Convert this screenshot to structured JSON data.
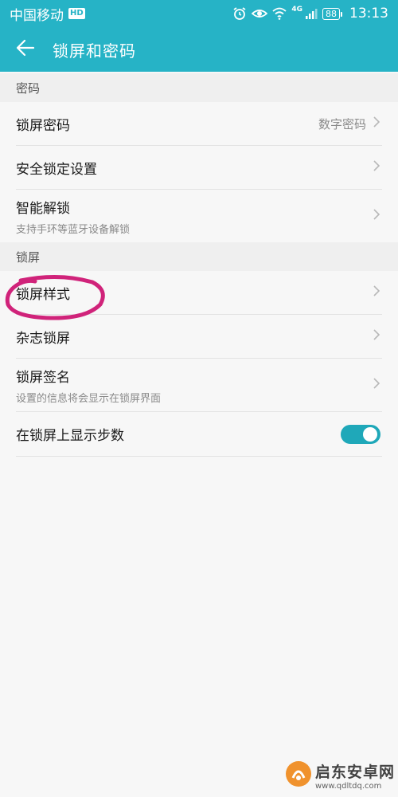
{
  "status_bar": {
    "carrier": "中国移动",
    "hd_badge": "HD",
    "network_badge": "4G",
    "battery": "88",
    "time": "13:13"
  },
  "app_bar": {
    "title": "锁屏和密码"
  },
  "sections": {
    "password": {
      "header": "密码",
      "rows": {
        "lock_password": {
          "title": "锁屏密码",
          "value": "数字密码"
        },
        "security_lock": {
          "title": "安全锁定设置"
        },
        "smart_unlock": {
          "title": "智能解锁",
          "subtitle": "支持手环等蓝牙设备解锁"
        }
      }
    },
    "lockscreen": {
      "header": "锁屏",
      "rows": {
        "lock_style": {
          "title": "锁屏样式"
        },
        "magazine_lock": {
          "title": "杂志锁屏"
        },
        "lock_signature": {
          "title": "锁屏签名",
          "subtitle": "设置的信息将会显示在锁屏界面"
        },
        "show_steps": {
          "title": "在锁屏上显示步数",
          "enabled": true
        }
      }
    }
  },
  "watermark": {
    "name": "启东安卓网",
    "url": "www.qdltdq.com"
  },
  "colors": {
    "accent": "#26b3c6",
    "toggle_on": "#1fa8b9",
    "annotation": "#d0237a"
  }
}
